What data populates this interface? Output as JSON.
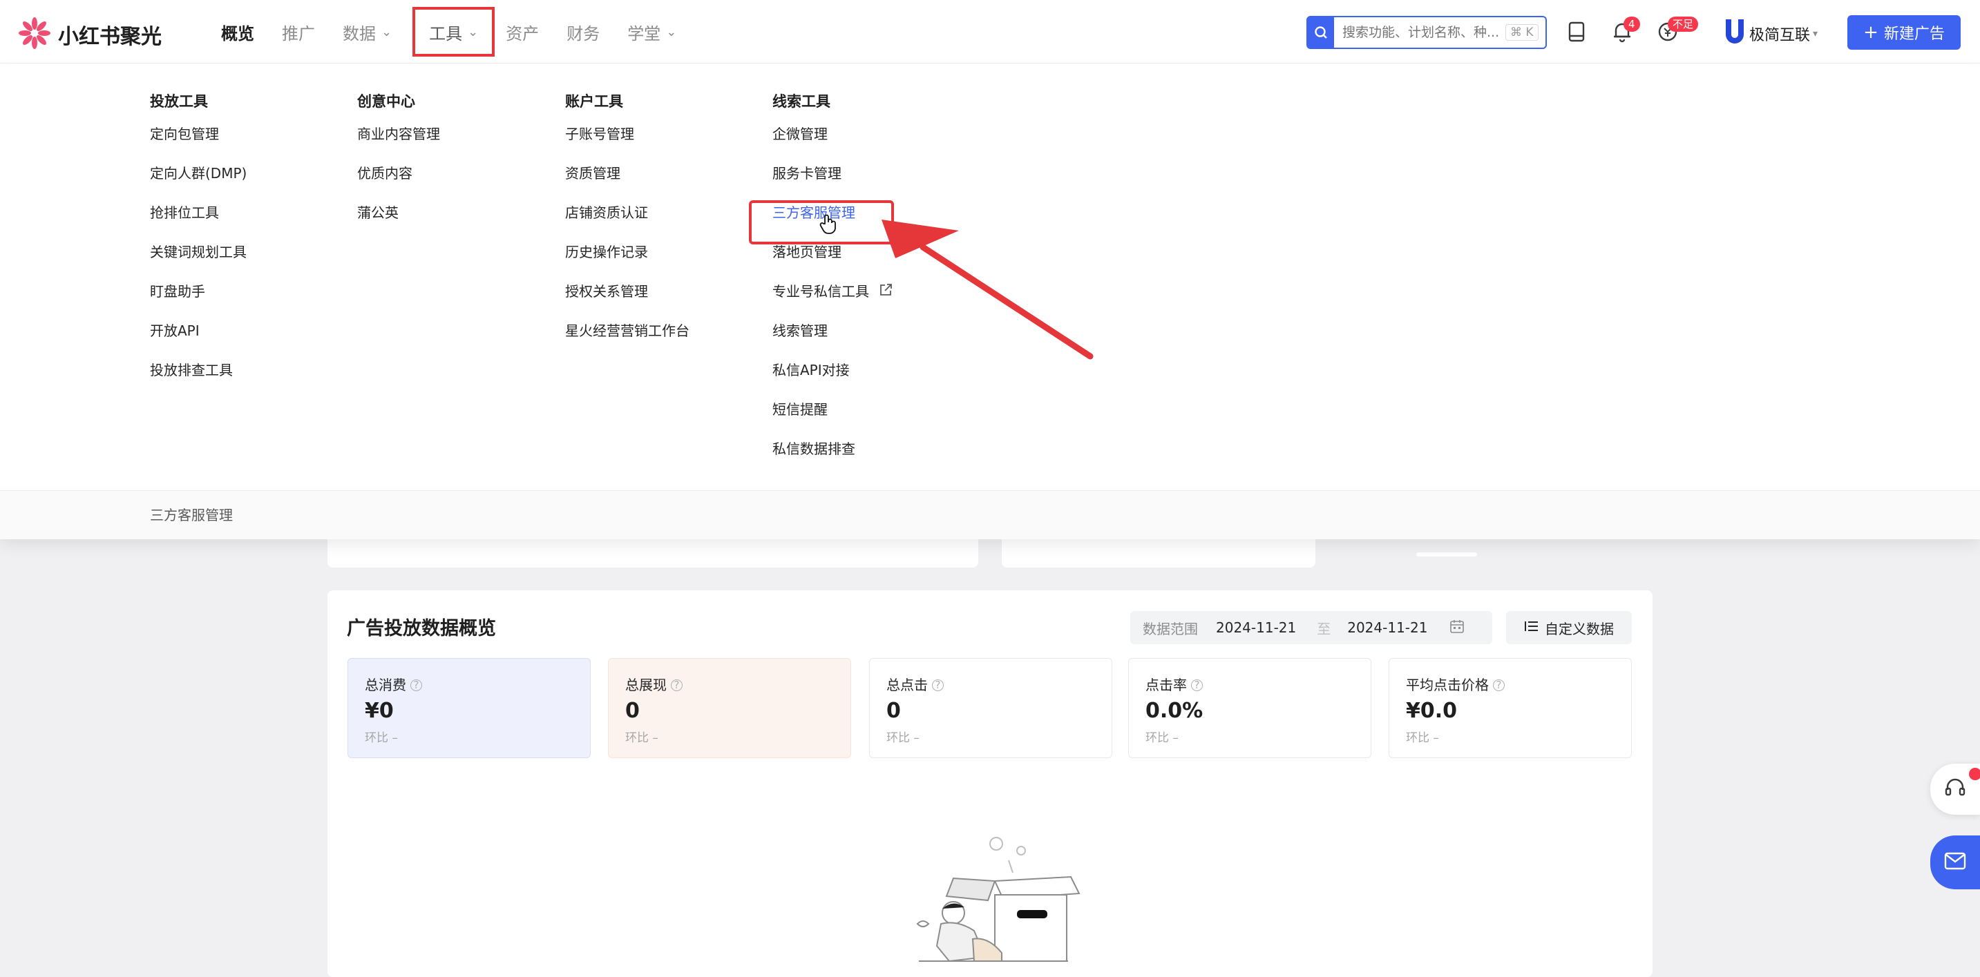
{
  "app": {
    "logo_text": "小红书聚光"
  },
  "nav": {
    "items": [
      {
        "label": "概览"
      },
      {
        "label": "推广"
      },
      {
        "label": "数据"
      },
      {
        "label": "工具"
      },
      {
        "label": "资产"
      },
      {
        "label": "财务"
      },
      {
        "label": "学堂"
      }
    ]
  },
  "search": {
    "placeholder": "搜索功能、计划名称、种...",
    "shortcut": "⌘ K"
  },
  "header": {
    "notification_count": "4",
    "balance_badge": "不足",
    "account_name": "极简互联",
    "new_ad_label": "新建广告"
  },
  "menu": {
    "columns": [
      {
        "title": "投放工具",
        "items": [
          "定向包管理",
          "定向人群(DMP)",
          "抢排位工具",
          "关键词规划工具",
          "盯盘助手",
          "开放API",
          "投放排查工具"
        ]
      },
      {
        "title": "创意中心",
        "items": [
          "商业内容管理",
          "优质内容",
          "蒲公英"
        ]
      },
      {
        "title": "账户工具",
        "items": [
          "子账号管理",
          "资质管理",
          "店铺资质认证",
          "历史操作记录",
          "授权关系管理",
          "星火经营营销工作台"
        ]
      },
      {
        "title": "线索工具",
        "items": [
          "企微管理",
          "服务卡管理",
          "三方客服管理",
          "落地页管理",
          "专业号私信工具",
          "线索管理",
          "私信API对接",
          "短信提醒",
          "私信数据排查"
        ]
      }
    ],
    "hovered_item": "三方客服管理",
    "footer_text": "三方客服管理"
  },
  "overview": {
    "title": "广告投放数据概览",
    "range_label": "数据范围",
    "start_date": "2024-11-21",
    "to_label": "至",
    "end_date": "2024-11-21",
    "custom_label": "自定义数据",
    "metrics": [
      {
        "label": "总消费",
        "value": "¥0",
        "sub": "环比 –"
      },
      {
        "label": "总展现",
        "value": "0",
        "sub": "环比 –"
      },
      {
        "label": "总点击",
        "value": "0",
        "sub": "环比 –"
      },
      {
        "label": "点击率",
        "value": "0.0%",
        "sub": "环比 –"
      },
      {
        "label": "平均点击价格",
        "value": "¥0.0",
        "sub": "环比 –"
      }
    ]
  },
  "colors": {
    "accent": "#3e63f0",
    "annotation_red": "#e5363a",
    "badge_red": "#f5384b"
  },
  "icons": [
    "flower-logo-icon",
    "search-icon",
    "tablet-icon",
    "bell-icon",
    "coin-icon",
    "brand-u-icon",
    "plus-icon",
    "external-link-icon",
    "hand-cursor-icon",
    "calendar-icon",
    "settings-list-icon",
    "headset-icon",
    "mail-icon",
    "question-icon"
  ]
}
